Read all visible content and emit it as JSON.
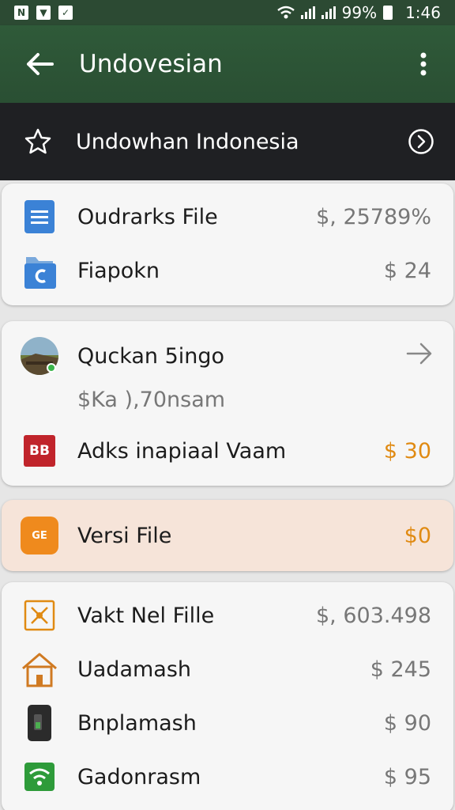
{
  "status": {
    "notif_icons": [
      "N",
      "▼",
      "✓"
    ],
    "battery": "99%",
    "time": "1:46"
  },
  "appbar": {
    "title": "Undovesian",
    "back_icon": "arrow-left-icon",
    "menu_icon": "more-vert-icon"
  },
  "header_row": {
    "label": "Undowhan Indonesia",
    "star_icon": "star-icon",
    "go_icon": "chevron-circle-icon"
  },
  "card1": [
    {
      "name": "Oudrarks File",
      "value": "$, 25789%",
      "icon": "document-icon"
    },
    {
      "name": "Fiapokn",
      "value": "$ 24",
      "icon": "folder-c-icon"
    }
  ],
  "card2": {
    "top": {
      "name": "Quckan 5ingo",
      "sub": "$Ka ),70nsam",
      "icon": "avatar-photo-icon",
      "arrow": "arrow-right-icon"
    },
    "bottom": {
      "name": "Adks inapiaal Vaam",
      "value": "$ 30",
      "icon_text": "BB"
    }
  },
  "card3": {
    "name": "Versi File",
    "value": "$0",
    "icon_text": "GE"
  },
  "card4": [
    {
      "name": "Vakt Nel Fille",
      "value": "$, 603.498",
      "icon": "transfer-icon"
    },
    {
      "name": "Uadamash",
      "value": "$ 245",
      "icon": "house-icon"
    },
    {
      "name": "Bnplamash",
      "value": "$ 90",
      "icon": "phone-device-icon"
    },
    {
      "name": "Gadonrasm",
      "value": "$ 95",
      "icon": "wifi-icon"
    }
  ],
  "colors": {
    "appbar": "#2f5a39",
    "header": "#1f2023",
    "accent_orange": "#e08a12",
    "peach_card": "#f6e4d9"
  }
}
